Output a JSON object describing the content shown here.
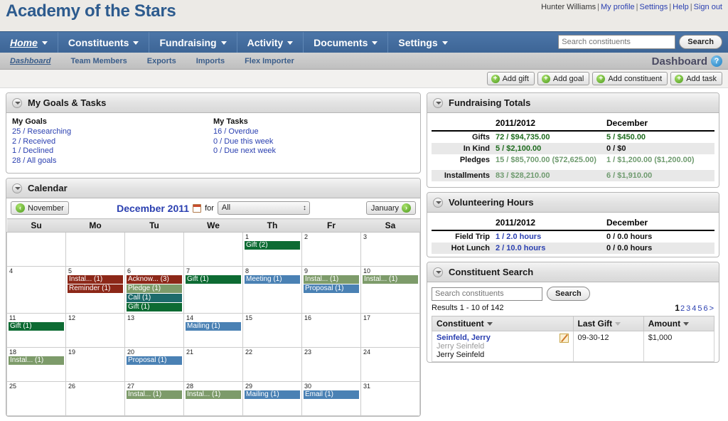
{
  "header": {
    "brand": "Academy of the Stars",
    "user": "Hunter Williams",
    "links": [
      "My profile",
      "Settings",
      "Help",
      "Sign out"
    ]
  },
  "mainnav": {
    "items": [
      {
        "label": "Home",
        "active": true
      },
      {
        "label": "Constituents",
        "active": false
      },
      {
        "label": "Fundraising",
        "active": false
      },
      {
        "label": "Activity",
        "active": false
      },
      {
        "label": "Documents",
        "active": false
      },
      {
        "label": "Settings",
        "active": false
      }
    ],
    "search_placeholder": "Search constituents",
    "search_value": "",
    "search_button": "Search"
  },
  "subnav": {
    "items": [
      "Dashboard",
      "Team Members",
      "Exports",
      "Imports",
      "Flex Importer"
    ],
    "page_title": "Dashboard",
    "help_glyph": "?"
  },
  "actionbar": {
    "buttons": [
      "Add gift",
      "Add goal",
      "Add constituent",
      "Add task"
    ]
  },
  "goals_panel": {
    "title": "My Goals & Tasks",
    "goals_heading": "My Goals",
    "goals": [
      "25 / Researching",
      "2 / Received",
      "1 / Declined",
      "28 / All goals"
    ],
    "tasks_heading": "My Tasks",
    "tasks": [
      "16 / Overdue",
      "0 / Due this week",
      "0 / Due next week"
    ]
  },
  "calendar": {
    "title": "Calendar",
    "prev_label": "November",
    "next_label": "January",
    "month_label": "December 2011",
    "for_label": "for",
    "filter_value": "All",
    "daynames": [
      "Su",
      "Mo",
      "Tu",
      "We",
      "Th",
      "Fr",
      "Sa"
    ],
    "weeks": [
      [
        {
          "day": ""
        },
        {
          "day": ""
        },
        {
          "day": ""
        },
        {
          "day": ""
        },
        {
          "day": "1",
          "events": [
            {
              "label": "Gift (2)",
              "color": "#0d6b33"
            }
          ]
        },
        {
          "day": "2"
        },
        {
          "day": "3"
        }
      ],
      [
        {
          "day": "4"
        },
        {
          "day": "5",
          "events": [
            {
              "label": "Instal... (1)",
              "color": "#8c2718"
            },
            {
              "label": "Reminder (1)",
              "color": "#8c2718"
            }
          ]
        },
        {
          "day": "6",
          "events": [
            {
              "label": "Acknow... (3)",
              "color": "#8c2718"
            },
            {
              "label": "Pledge (1)",
              "color": "#7d9b6a"
            },
            {
              "label": "Call (1)",
              "color": "#1d6b6b"
            },
            {
              "label": "Gift (1)",
              "color": "#0d6b33"
            }
          ]
        },
        {
          "day": "7",
          "events": [
            {
              "label": "Gift (1)",
              "color": "#0d6b33"
            }
          ]
        },
        {
          "day": "8",
          "events": [
            {
              "label": "Meeting (1)",
              "color": "#4a81b4"
            }
          ]
        },
        {
          "day": "9",
          "events": [
            {
              "label": "Instal... (1)",
              "color": "#7d9b6a"
            },
            {
              "label": "Proposal (1)",
              "color": "#4a81b4"
            }
          ]
        },
        {
          "day": "10",
          "events": [
            {
              "label": "Instal... (1)",
              "color": "#7d9b6a"
            }
          ]
        }
      ],
      [
        {
          "day": "11",
          "events": [
            {
              "label": "Gift (1)",
              "color": "#0d6b33"
            }
          ]
        },
        {
          "day": "12"
        },
        {
          "day": "13"
        },
        {
          "day": "14",
          "events": [
            {
              "label": "Mailing (1)",
              "color": "#4a81b4"
            }
          ]
        },
        {
          "day": "15"
        },
        {
          "day": "16"
        },
        {
          "day": "17"
        }
      ],
      [
        {
          "day": "18",
          "events": [
            {
              "label": "Instal... (1)",
              "color": "#7d9b6a"
            }
          ]
        },
        {
          "day": "19"
        },
        {
          "day": "20",
          "events": [
            {
              "label": "Proposal (1)",
              "color": "#4a81b4"
            }
          ]
        },
        {
          "day": "21"
        },
        {
          "day": "22"
        },
        {
          "day": "23"
        },
        {
          "day": "24"
        }
      ],
      [
        {
          "day": "25"
        },
        {
          "day": "26"
        },
        {
          "day": "27",
          "events": [
            {
              "label": "Instal... (1)",
              "color": "#7d9b6a"
            }
          ]
        },
        {
          "day": "28",
          "events": [
            {
              "label": "Instal... (1)",
              "color": "#7d9b6a"
            }
          ]
        },
        {
          "day": "29",
          "events": [
            {
              "label": "Mailing (1)",
              "color": "#4a81b4"
            }
          ]
        },
        {
          "day": "30",
          "events": [
            {
              "label": "Email (1)",
              "color": "#4a81b4"
            }
          ]
        },
        {
          "day": "31"
        }
      ]
    ]
  },
  "fundraising": {
    "title": "Fundraising Totals",
    "col1": "2011/2012",
    "col2": "December",
    "rows": [
      {
        "label": "Gifts",
        "v1": "72 / $94,735.00",
        "v2": "5 / $450.00",
        "style": "money",
        "alt": false
      },
      {
        "label": "In Kind",
        "v1": "5 / $2,100.00",
        "v2": "0 / $0",
        "style": "money",
        "alt": true
      },
      {
        "label": "Pledges",
        "v1": "15 / $85,700.00 ($72,625.00)",
        "v2": "1 / $1,200.00 ($1,200.00)",
        "style": "money-muted",
        "alt": false
      },
      {
        "label": "Installments",
        "v1": "83 / $28,210.00",
        "v2": "6 / $1,910.00",
        "style": "money-muted",
        "alt": true
      }
    ]
  },
  "volunteering": {
    "title": "Volunteering Hours",
    "col1": "2011/2012",
    "col2": "December",
    "rows": [
      {
        "label": "Field Trip",
        "v1": "1 / 2.0 hours",
        "v2": "0 / 0.0 hours",
        "alt": false
      },
      {
        "label": "Hot Lunch",
        "v1": "2 / 10.0 hours",
        "v2": "0 / 0.0 hours",
        "alt": true
      }
    ]
  },
  "constituent_search": {
    "title": "Constituent Search",
    "search_placeholder": "Search constituents",
    "search_value": "",
    "search_button": "Search",
    "results_text": "Results 1 - 10 of 142",
    "pager_current": "1",
    "pager_pages": [
      "2",
      "3",
      "4",
      "5",
      "6",
      ">"
    ],
    "columns": [
      "Constituent",
      "Last Gift",
      "Amount"
    ],
    "rows": [
      {
        "name": "Seinfeld, Jerry",
        "alt1": "Jerry Seinfeld",
        "alt2": "Jerry Seinfeld",
        "last_gift": "09-30-12",
        "amount": "$1,000"
      }
    ]
  }
}
